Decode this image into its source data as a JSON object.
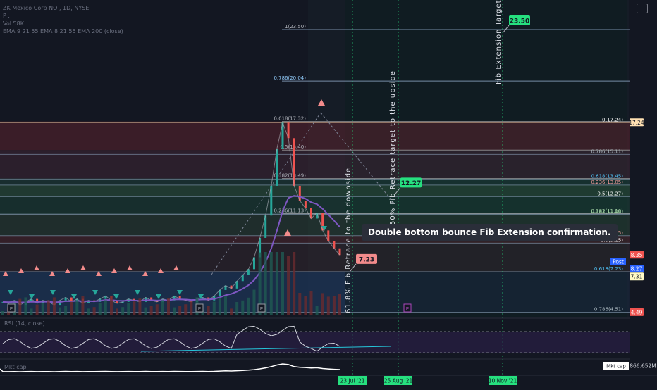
{
  "header": {
    "lines": [
      "ZK Mexico Corp NO , 1D, NYSE",
      "P . ",
      "Vol 58K",
      "EMA 9 21 55 EMA 8 21 55 EMA 200 (close)"
    ]
  },
  "indicators": {
    "rsi_label": "RSI (14, close)",
    "mktcap_label": "Mkt cap",
    "mktcap_value": "866.652M"
  },
  "colors": {
    "bg": "#131722",
    "up": "#26a69a",
    "down": "#ef5350",
    "ema_purple": "#7e57c2",
    "green_tag": "#26e07f",
    "red_tag": "#ef9a9a"
  },
  "chart_data": {
    "type": "line",
    "y_range": [
      4.2,
      25.2
    ],
    "fib_retrace_left": [
      {
        "label": "1(23.50)",
        "value": 23.5
      },
      {
        "label": "0.786(20.04)",
        "value": 20.04
      },
      {
        "label": "0.618(17.32)",
        "value": 17.32
      },
      {
        "label": "0.5(15.40)",
        "value": 15.4
      },
      {
        "label": "0.382(13.49)",
        "value": 13.49
      },
      {
        "label": "0.236(11.13)",
        "value": 11.13
      }
    ],
    "fib_retrace_right": [
      {
        "label": "0(17.24)",
        "value": 17.24
      },
      {
        "label": "0.786(15.11)",
        "value": 15.11
      },
      {
        "label": "0.618(13.45)",
        "value": 13.45
      },
      {
        "label": "0.236(13.05)",
        "value": 13.05
      },
      {
        "label": "0.5(12.27)",
        "value": 12.27
      },
      {
        "label": "0.382(11.10)",
        "value": 11.1
      },
      {
        "label": "0.382(11.06)",
        "value": 11.06
      },
      {
        "label": "0.236(9.65)",
        "value": 9.65
      },
      {
        "label": "0.5(9.15)",
        "value": 9.15
      },
      {
        "label": "0.618(7.23)",
        "value": 7.23
      },
      {
        "label": "0.786(4.51)",
        "value": 4.51
      }
    ],
    "price_tags": [
      {
        "label": "17.24",
        "value": 17.24,
        "color": "#ffe0b2",
        "text_color": "#131722"
      },
      {
        "label": "8.35",
        "value": 8.35,
        "color": "#ef5350",
        "text_color": "#ffffff"
      },
      {
        "label": "Post",
        "value": 8.27,
        "color": "#2962ff",
        "text_color": "#ffffff",
        "label_only": true
      },
      {
        "label": "8.27",
        "value": 8.27,
        "color": "#2962ff",
        "text_color": "#ffffff",
        "offset_x": 0
      },
      {
        "label": "7.31",
        "value": 7.31,
        "color": "#fff9c4",
        "text_color": "#131722"
      },
      {
        "label": "4.49",
        "value": 4.49,
        "color": "#ef5350",
        "text_color": "#ffffff"
      }
    ],
    "targets": [
      {
        "label": "23.50",
        "value": 23.5,
        "color": "#26e07f"
      },
      {
        "label": "12.27",
        "value": 12.27,
        "color": "#26e07f"
      },
      {
        "label": "7.23",
        "value": 7.23,
        "color": "#f28b8b"
      }
    ],
    "vertical_annotations": [
      "61.8% Fib Retrace to the downside",
      "50% Fib Retrace target to the upside",
      "Fib Extension Target #1"
    ],
    "date_markers": [
      "23 Jul '21",
      "25 Aug '21",
      "10 Nov '21"
    ],
    "note": "Double bottom bounce Fib Extension confirmation.",
    "price_series": [
      5.2,
      5.1,
      5.3,
      5.0,
      5.2,
      5.4,
      5.1,
      5.3,
      5.2,
      5.0,
      5.3,
      5.5,
      5.2,
      5.4,
      5.1,
      5.3,
      5.2,
      5.4,
      5.6,
      5.3,
      5.1,
      5.2,
      5.4,
      5.3,
      5.2,
      5.5,
      5.3,
      5.2,
      5.4,
      5.3,
      5.6,
      5.4,
      5.3,
      5.2,
      5.4,
      5.5,
      5.3,
      5.6,
      6.0,
      6.3,
      6.1,
      6.6,
      7.0,
      7.4,
      8.2,
      9.5,
      11.0,
      13.0,
      15.5,
      17.24,
      16.2,
      13.0,
      12.0,
      11.5,
      10.8,
      11.2,
      10.0,
      9.3,
      8.8,
      8.35
    ]
  }
}
